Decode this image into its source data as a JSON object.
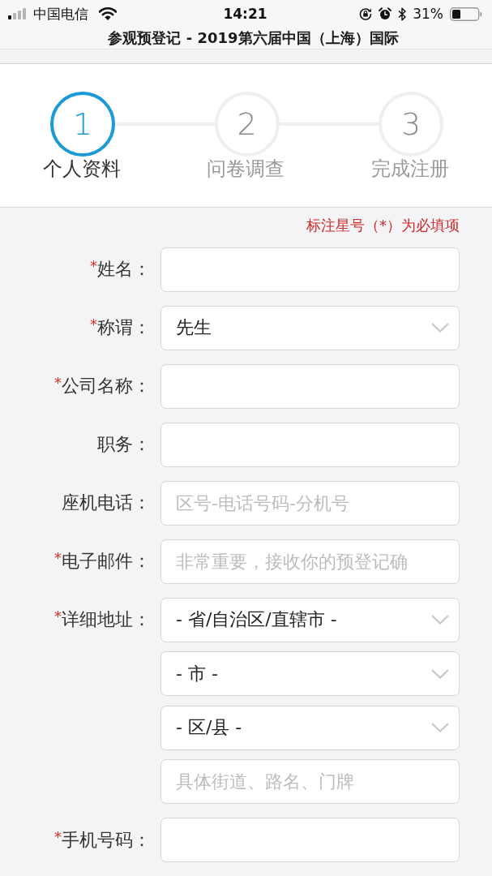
{
  "status_bar": {
    "carrier": "中国电信",
    "time": "14:21",
    "battery": "31%"
  },
  "page_title": "参观预登记 - 2019第六届中国（上海）国际",
  "steps": [
    {
      "number": "1",
      "label": "个人资料",
      "current": true
    },
    {
      "number": "2",
      "label": "问卷调查",
      "current": false
    },
    {
      "number": "3",
      "label": "完成注册",
      "current": false
    }
  ],
  "required_note": "标注星号（*）为必填项",
  "form": {
    "required_mark": "*",
    "fields": [
      {
        "label": "姓名：",
        "required": true,
        "inputs": [
          {
            "kind": "text"
          }
        ]
      },
      {
        "label": "称谓：",
        "required": true,
        "inputs": [
          {
            "kind": "select",
            "value": "先生"
          }
        ]
      },
      {
        "label": "公司名称：",
        "required": true,
        "inputs": [
          {
            "kind": "text"
          }
        ]
      },
      {
        "label": "职务：",
        "required": false,
        "inputs": [
          {
            "kind": "text"
          }
        ]
      },
      {
        "label": "座机电话：",
        "required": false,
        "inputs": [
          {
            "kind": "text",
            "placeholder": "区号-电话号码-分机号"
          }
        ]
      },
      {
        "label": "电子邮件：",
        "required": true,
        "inputs": [
          {
            "kind": "text",
            "placeholder": "非常重要，接收你的预登记确"
          }
        ]
      },
      {
        "label": "详细地址：",
        "required": true,
        "inputs": [
          {
            "kind": "select",
            "value": "- 省/自治区/直辖市 -"
          },
          {
            "kind": "select",
            "value": "- 市 -"
          },
          {
            "kind": "select",
            "value": "- 区/县 -"
          },
          {
            "kind": "text",
            "placeholder": "具体街道、路名、门牌"
          }
        ]
      },
      {
        "label": "手机号码：",
        "required": true,
        "inputs": [
          {
            "kind": "text"
          }
        ]
      }
    ]
  }
}
